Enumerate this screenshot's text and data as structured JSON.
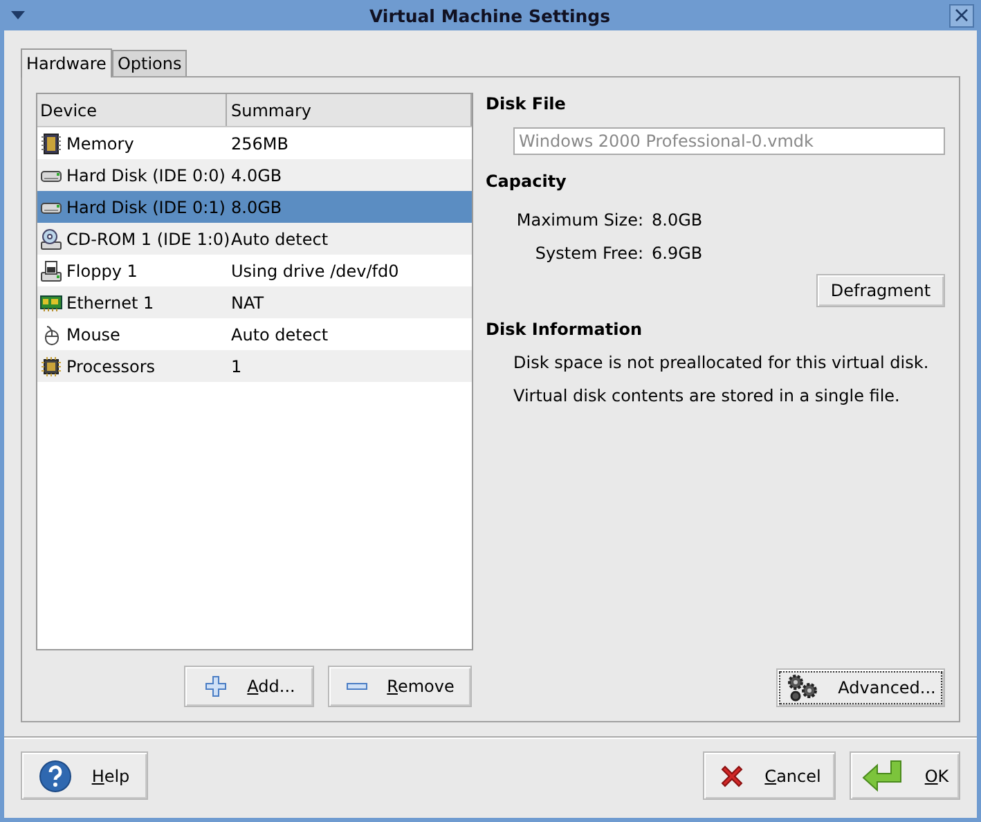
{
  "window": {
    "title": "Virtual Machine Settings"
  },
  "tabs": [
    {
      "label": "Hardware",
      "selected": true
    },
    {
      "label": "Options",
      "selected": false
    }
  ],
  "device_table": {
    "columns": [
      "Device",
      "Summary"
    ],
    "rows": [
      {
        "kind": "memory",
        "device": "Memory",
        "summary": "256MB",
        "selected": false
      },
      {
        "kind": "disk",
        "device": "Hard Disk (IDE 0:0)",
        "summary": "4.0GB",
        "selected": false
      },
      {
        "kind": "disk",
        "device": "Hard Disk (IDE 0:1)",
        "summary": "8.0GB",
        "selected": true
      },
      {
        "kind": "cdrom",
        "device": "CD-ROM 1 (IDE 1:0)",
        "summary": "Auto detect",
        "selected": false
      },
      {
        "kind": "floppy",
        "device": "Floppy 1",
        "summary": "Using drive /dev/fd0",
        "selected": false
      },
      {
        "kind": "ethernet",
        "device": "Ethernet 1",
        "summary": "NAT",
        "selected": false
      },
      {
        "kind": "mouse",
        "device": "Mouse",
        "summary": "Auto detect",
        "selected": false
      },
      {
        "kind": "cpu",
        "device": "Processors",
        "summary": "1",
        "selected": false
      }
    ]
  },
  "list_buttons": [
    {
      "kind": "add",
      "label": "Add...",
      "underline_first": true
    },
    {
      "kind": "remove",
      "label": "Remove",
      "underline_first": true
    }
  ],
  "disk_file": {
    "heading": "Disk File",
    "value": "Windows 2000 Professional-0.vmdk",
    "disabled": true
  },
  "capacity": {
    "heading": "Capacity",
    "fields": [
      {
        "label": "Maximum Size:",
        "value": "8.0GB"
      },
      {
        "label": "System Free:",
        "value": "6.9GB"
      }
    ],
    "button": "Defragment"
  },
  "disk_information": {
    "heading": "Disk Information",
    "lines": [
      "Disk space is not preallocated for this virtual disk.",
      "Virtual disk contents are stored in a single file."
    ]
  },
  "advanced_button": {
    "label": "Advanced...",
    "focused": true
  },
  "dialog_buttons": [
    {
      "kind": "help",
      "label": "Help",
      "underline_first": true
    },
    {
      "kind": "cancel",
      "label": "Cancel",
      "underline_first": true
    },
    {
      "kind": "ok",
      "label": "OK",
      "underline_first": true
    }
  ]
}
